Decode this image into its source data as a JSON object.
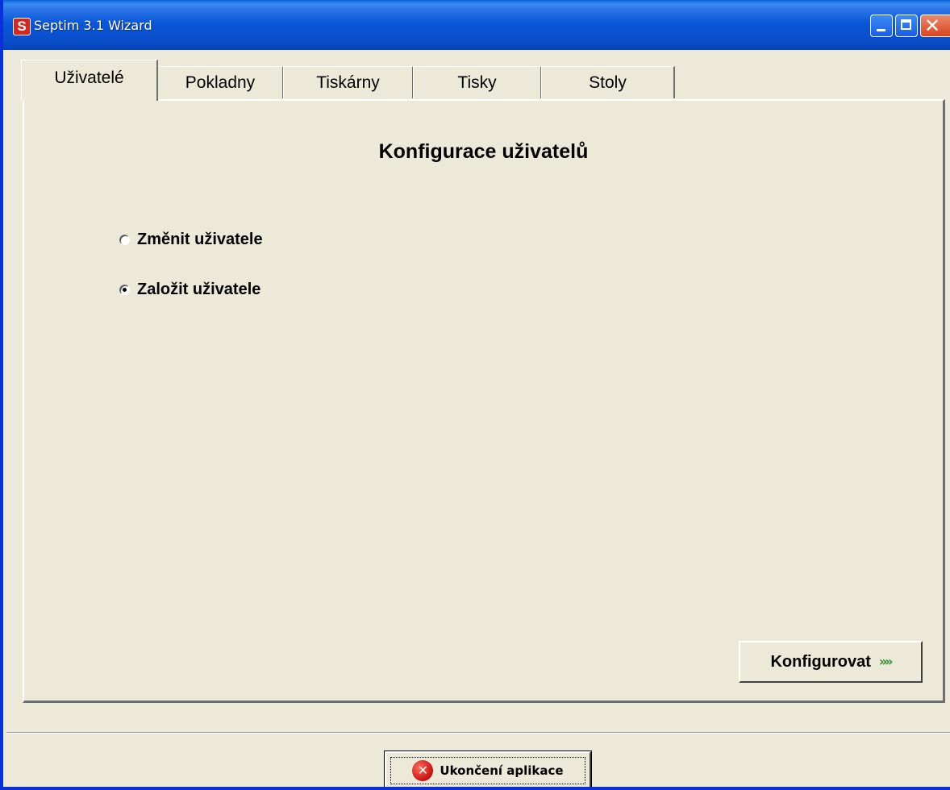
{
  "window": {
    "title": "Septim 3.1 Wizard",
    "app_icon": "S",
    "controls": {
      "minimize_icon": "minimize-icon",
      "maximize_icon": "maximize-icon",
      "close_icon": "close-icon"
    },
    "title_bar_color": "#0a57d9"
  },
  "tabs": [
    {
      "label": "Uživatelé",
      "active": true
    },
    {
      "label": "Pokladny",
      "active": false
    },
    {
      "label": "Tiskárny",
      "active": false
    },
    {
      "label": "Tisky",
      "active": false
    },
    {
      "label": "Stoly",
      "active": false
    }
  ],
  "panel": {
    "heading": "Konfigurace uživatelů",
    "options": [
      {
        "label": "Změnit uživatele",
        "checked": false
      },
      {
        "label": "Založit uživatele",
        "checked": true
      }
    ],
    "configure_button": {
      "label": "Konfigurovat",
      "icon": "double-chevron-right-icon",
      "glyph": "»»"
    }
  },
  "footer": {
    "exit_button": {
      "label": "Ukončení aplikace",
      "icon": "error-icon",
      "glyph": "✕"
    }
  }
}
